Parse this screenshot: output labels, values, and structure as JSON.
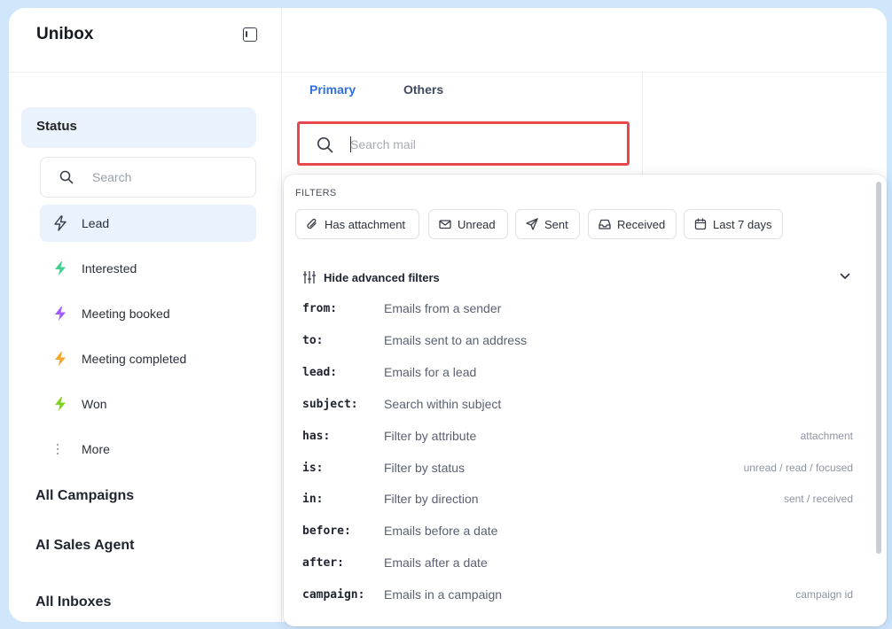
{
  "app": {
    "title": "Unibox"
  },
  "sidebar": {
    "status_label": "Status",
    "search_placeholder": "Search",
    "status_items": [
      {
        "label": "Lead",
        "icon": "lightning-outline-icon",
        "color": "#3a3f4a",
        "active": true
      },
      {
        "label": "Interested",
        "icon": "lightning-icon",
        "color": "#3fcf8e"
      },
      {
        "label": "Meeting booked",
        "icon": "lightning-icon",
        "color": "#a259ff"
      },
      {
        "label": "Meeting completed",
        "icon": "lightning-icon",
        "color": "#f5a623"
      },
      {
        "label": "Won",
        "icon": "lightning-icon",
        "color": "#7ed321"
      },
      {
        "label": "More",
        "icon": "more-vertical-icon",
        "color": "#9aa0aa"
      }
    ],
    "sections": [
      "All Campaigns",
      "AI Sales Agent",
      "All Inboxes"
    ]
  },
  "mail": {
    "tabs": [
      {
        "label": "Primary",
        "active": true
      },
      {
        "label": "Others",
        "active": false
      }
    ],
    "search_placeholder": "Search mail"
  },
  "filters": {
    "title": "FILTERS",
    "chips": [
      {
        "label": "Has attachment",
        "icon": "paperclip-icon"
      },
      {
        "label": "Unread",
        "icon": "envelope-icon"
      },
      {
        "label": "Sent",
        "icon": "send-icon"
      },
      {
        "label": "Received",
        "icon": "inbox-icon"
      },
      {
        "label": "Last 7 days",
        "icon": "calendar-icon"
      }
    ],
    "advanced_label": "Hide advanced filters",
    "operators": [
      {
        "key": "from:",
        "desc": "Emails from a sender",
        "hint": ""
      },
      {
        "key": "to:",
        "desc": "Emails sent to an address",
        "hint": ""
      },
      {
        "key": "lead:",
        "desc": "Emails for a lead",
        "hint": ""
      },
      {
        "key": "subject:",
        "desc": "Search within subject",
        "hint": ""
      },
      {
        "key": "has:",
        "desc": "Filter by attribute",
        "hint": "attachment"
      },
      {
        "key": "is:",
        "desc": "Filter by status",
        "hint": "unread / read / focused"
      },
      {
        "key": "in:",
        "desc": "Filter by direction",
        "hint": "sent / received"
      },
      {
        "key": "before:",
        "desc": "Emails before a date",
        "hint": ""
      },
      {
        "key": "after:",
        "desc": "Emails after a date",
        "hint": ""
      },
      {
        "key": "campaign:",
        "desc": "Emails in a campaign",
        "hint": "campaign id"
      }
    ]
  },
  "colors": {
    "accent": "#2f6fe0",
    "highlight_border": "#e5484d",
    "active_bg": "#eaf3fd"
  }
}
